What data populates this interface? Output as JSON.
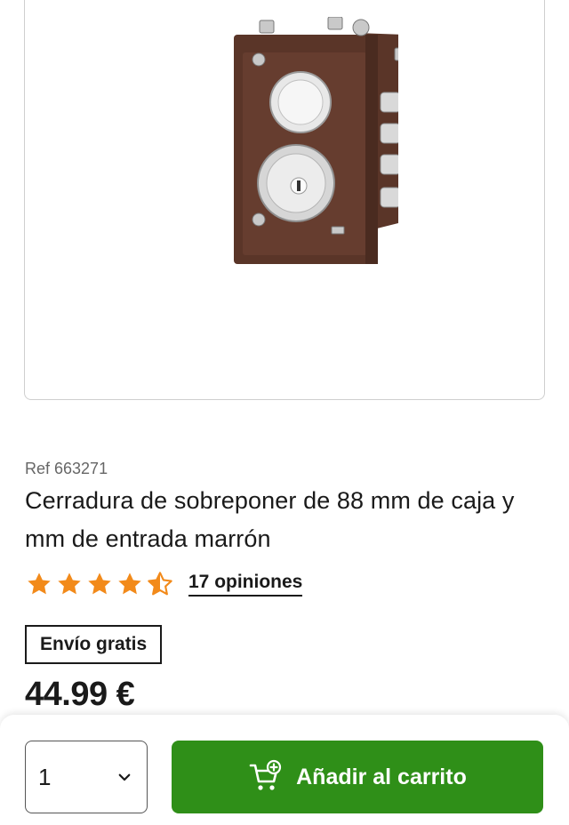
{
  "product": {
    "ref": "Ref 663271",
    "title": "Cerradura de sobreponer de 88 mm de caja y  mm de entrada marrón",
    "rating": 4.5,
    "rating_max": 5,
    "reviews_label": "17 opiniones",
    "shipping_badge": "Envío gratis",
    "price": "44.99 €"
  },
  "purchase_bar": {
    "quantity": "1",
    "add_to_cart_label": "Añadir al carrito"
  },
  "colors": {
    "accent_green": "#2f8f18",
    "star_orange": "#f28a1a",
    "lock_brown": "#5a3528"
  }
}
